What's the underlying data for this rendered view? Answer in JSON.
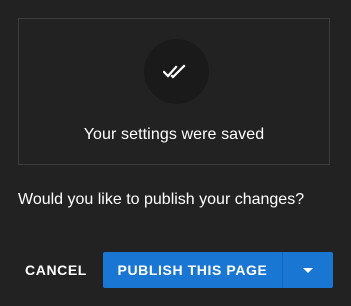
{
  "dialog": {
    "saved_message": "Your settings were saved",
    "question": "Would you like to publish your changes?",
    "icon": "double-check-icon",
    "actions": {
      "cancel_label": "CANCEL",
      "publish_label": "PUBLISH THIS PAGE",
      "dropdown_icon": "caret-down-icon"
    }
  },
  "colors": {
    "background": "#222222",
    "box_border": "#3c3c3c",
    "icon_circle": "#1a1a1a",
    "primary": "#1976d2"
  }
}
